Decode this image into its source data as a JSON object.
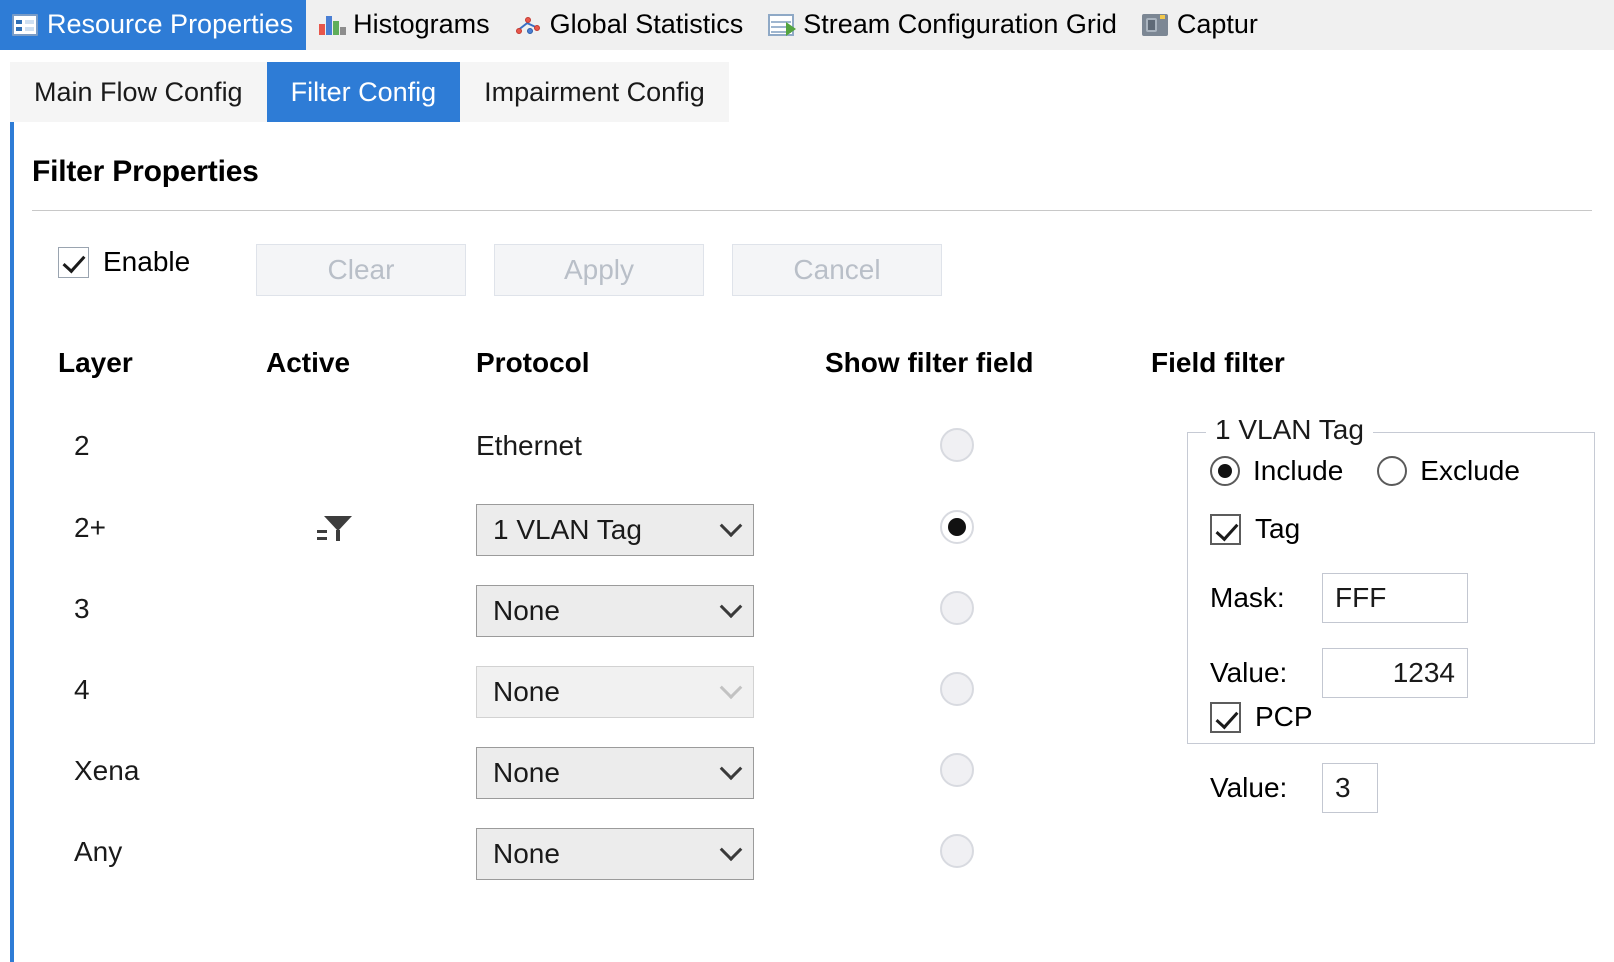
{
  "top_tabs": [
    {
      "label": "Resource Properties",
      "icon": "properties-grid-icon",
      "selected": true
    },
    {
      "label": "Histograms",
      "icon": "histogram-icon",
      "selected": false
    },
    {
      "label": "Global Statistics",
      "icon": "scatter-line-icon",
      "selected": false
    },
    {
      "label": "Stream Configuration Grid",
      "icon": "grid-export-icon",
      "selected": false
    },
    {
      "label": "Captur",
      "icon": "camera-icon",
      "selected": false
    }
  ],
  "sub_tabs": [
    {
      "label": "Main Flow Config",
      "selected": false
    },
    {
      "label": "Filter Config",
      "selected": true
    },
    {
      "label": "Impairment Config",
      "selected": false
    }
  ],
  "panel": {
    "title": "Filter Properties",
    "enable": {
      "label": "Enable",
      "checked": true
    },
    "buttons": [
      {
        "label": "Clear",
        "enabled": false
      },
      {
        "label": "Apply",
        "enabled": false
      },
      {
        "label": "Cancel",
        "enabled": false
      }
    ],
    "columns": [
      "Layer",
      "Active",
      "Protocol",
      "Show filter field",
      "Field filter"
    ],
    "rows": [
      {
        "layer": "2",
        "active_icon": "",
        "protocol": "Ethernet",
        "protocol_is_combo": false,
        "combo_enabled": false,
        "show_filter_field": false
      },
      {
        "layer": "2+",
        "active_icon": "filter-icon",
        "protocol": "1 VLAN Tag",
        "protocol_is_combo": true,
        "combo_enabled": true,
        "show_filter_field": true
      },
      {
        "layer": "3",
        "active_icon": "",
        "protocol": "None",
        "protocol_is_combo": true,
        "combo_enabled": true,
        "show_filter_field": false
      },
      {
        "layer": "4",
        "active_icon": "",
        "protocol": "None",
        "protocol_is_combo": true,
        "combo_enabled": false,
        "show_filter_field": false
      },
      {
        "layer": "Xena",
        "active_icon": "",
        "protocol": "None",
        "protocol_is_combo": true,
        "combo_enabled": true,
        "show_filter_field": false
      },
      {
        "layer": "Any",
        "active_icon": "",
        "protocol": "None",
        "protocol_is_combo": true,
        "combo_enabled": true,
        "show_filter_field": false
      }
    ]
  },
  "field_filter": {
    "group_title": "1 VLAN Tag",
    "include_label": "Include",
    "exclude_label": "Exclude",
    "include_selected": true,
    "tag": {
      "label": "Tag",
      "checked": true
    },
    "mask": {
      "label": "Mask:",
      "value": "FFF"
    },
    "tag_value": {
      "label": "Value:",
      "value": "1234"
    },
    "pcp": {
      "label": "PCP",
      "checked": true
    },
    "pcp_value": {
      "label": "Value:",
      "value": "3"
    }
  },
  "colors": {
    "accent": "#2e7cd6",
    "panel_bg": "#ffffff",
    "tabbar_bg": "#f0f0f0",
    "subtab_bg": "#f5f5f5",
    "disabled_text": "#b9bfc8",
    "combo_bg": "#ececec"
  }
}
